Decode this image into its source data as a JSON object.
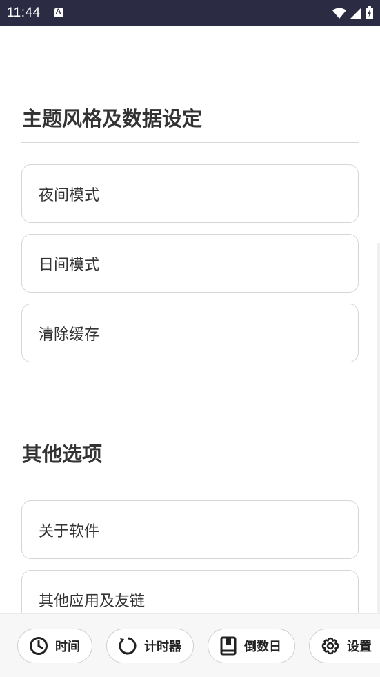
{
  "status_bar": {
    "time": "11:44"
  },
  "sections": [
    {
      "title": "主题风格及数据设定",
      "options": [
        "夜间模式",
        "日间模式",
        "清除缓存"
      ]
    },
    {
      "title": "其他选项",
      "options": [
        "关于软件",
        "其他应用及友链"
      ]
    }
  ],
  "bottom_nav": {
    "items": [
      {
        "label": "时间",
        "icon": "clock-icon"
      },
      {
        "label": "计时器",
        "icon": "refresh-icon"
      },
      {
        "label": "倒数日",
        "icon": "book-icon"
      },
      {
        "label": "设置",
        "icon": "gear-icon"
      }
    ]
  },
  "colors": {
    "status_bar_bg": "#2b2b44",
    "nav_bg": "#f7f7f7",
    "card_border": "#d6d6d6"
  }
}
